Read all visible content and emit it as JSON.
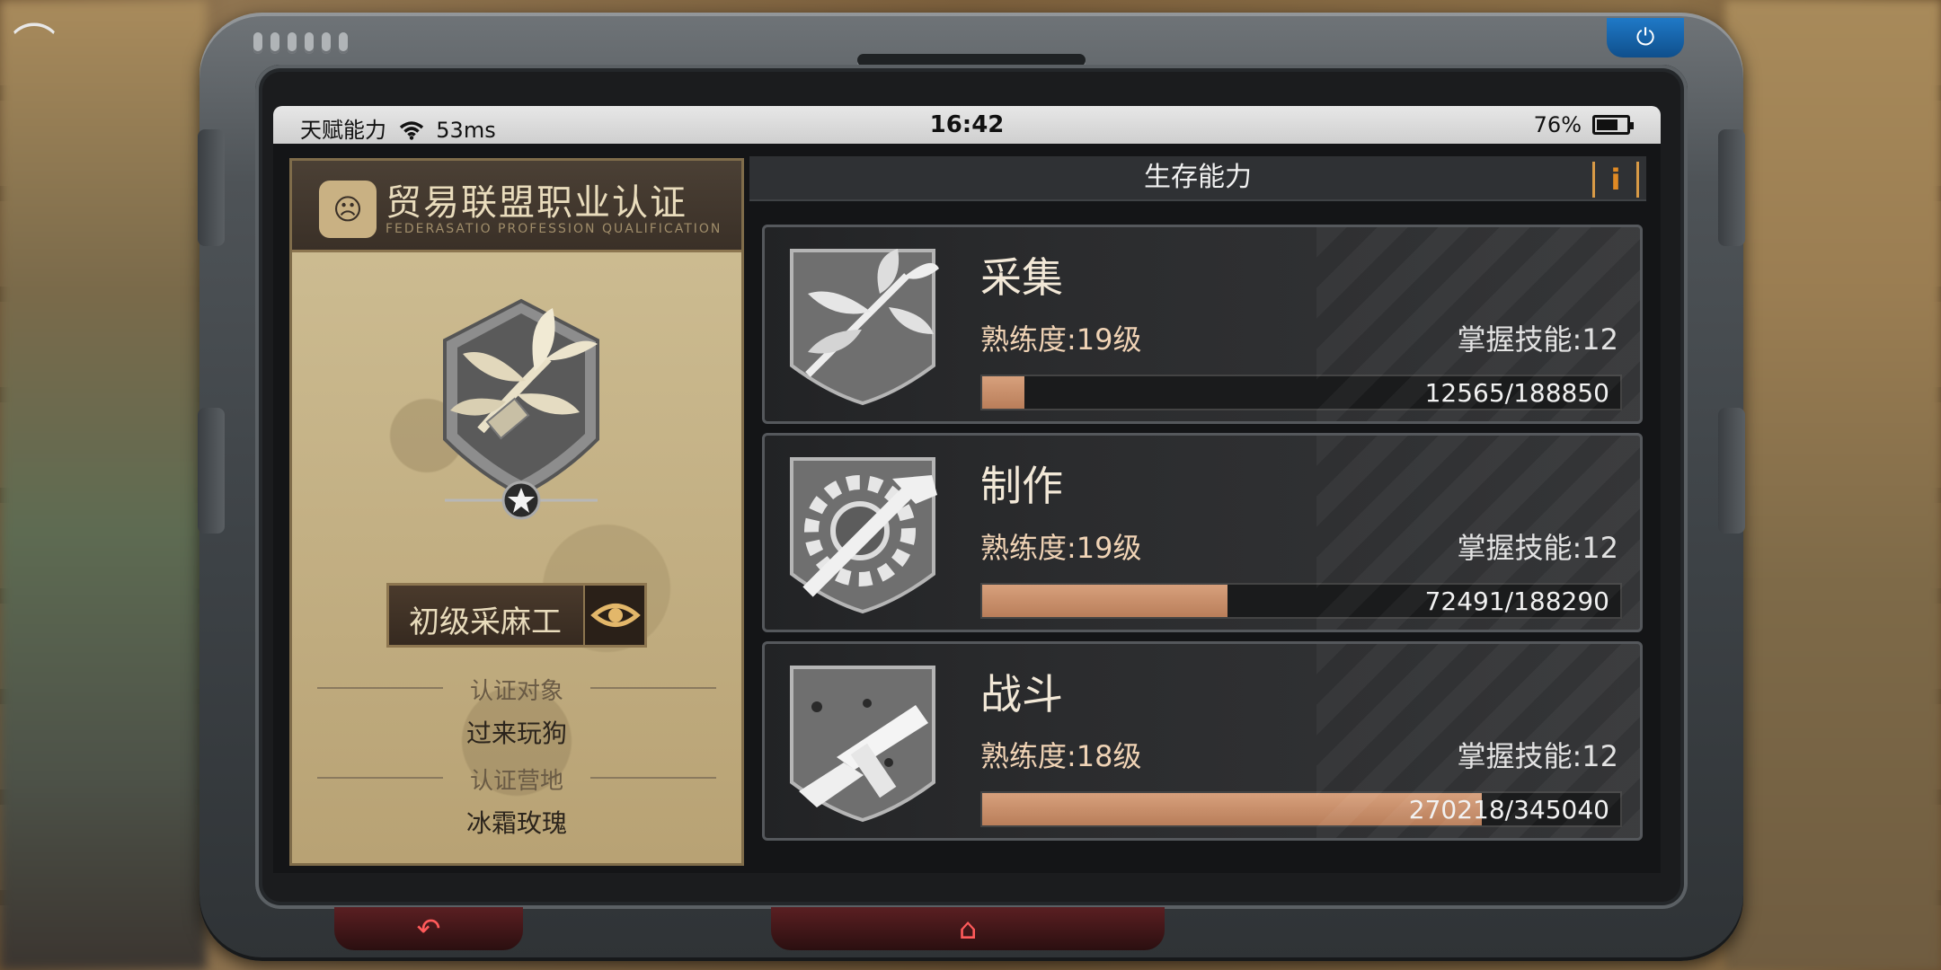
{
  "status_bar": {
    "network_label": "天赋能力",
    "latency": "53ms",
    "time": "16:42",
    "battery_percent": "76%",
    "battery_level": 0.76
  },
  "left_panel": {
    "title": "贸易联盟职业认证",
    "subtitle": "FEDERASATIO PROFESSION QUALIFICATION",
    "rank_name": "初级采麻工",
    "target_label": "认证对象",
    "target_value": "过来玩狗",
    "camp_label": "认证营地",
    "camp_value": "冰霜玫瑰"
  },
  "right_panel": {
    "header": "生存能力",
    "info_icon": "i"
  },
  "skills": [
    {
      "name": "采集",
      "proficiency": "熟练度:19级",
      "mastery": "掌握技能:12",
      "progress_text": "12565/188850",
      "current": 12565,
      "max": 188850,
      "icon": "leaf-bundle-icon"
    },
    {
      "name": "制作",
      "proficiency": "熟练度:19级",
      "mastery": "掌握技能:12",
      "progress_text": "72491/188290",
      "current": 72491,
      "max": 188290,
      "icon": "gear-hammer-icon"
    },
    {
      "name": "战斗",
      "proficiency": "熟练度:18级",
      "mastery": "掌握技能:12",
      "progress_text": "270218/345040",
      "current": 270218,
      "max": 345040,
      "icon": "submachine-gun-icon"
    }
  ],
  "nav": {
    "back_icon": "back-arrow-icon",
    "home_icon": "home-icon",
    "power_icon": "power-icon"
  },
  "colors": {
    "accent": "#d7a07c",
    "info": "#e08a24",
    "home_button": "#ff5a5a",
    "power_button": "#1f79c7"
  }
}
